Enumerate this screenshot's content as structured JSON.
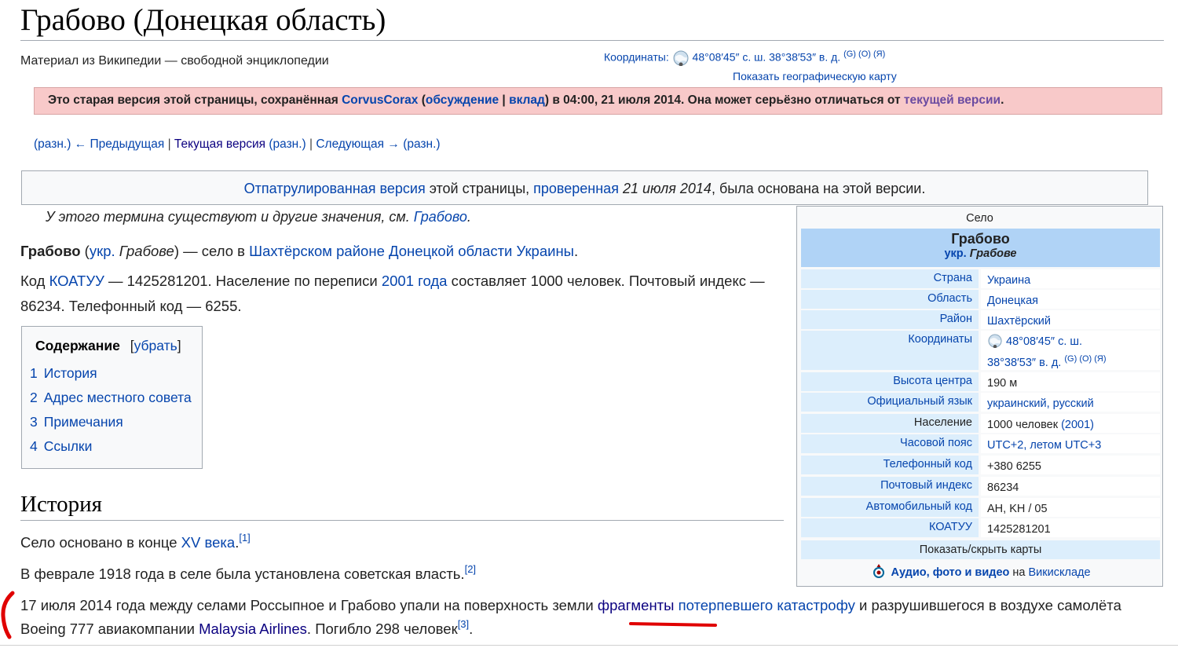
{
  "page": {
    "title": "Грабово (Донецкая область)",
    "tagline": "Материал из Википедии — свободной энциклопедии"
  },
  "coordinates": {
    "label": "Координаты:",
    "value": "48°08′45″ с. ш. 38°38′53″ в. д.",
    "g": "(G)",
    "o": "(O)",
    "ya": "(Я)",
    "map_link": "Показать географическую карту"
  },
  "old_version": {
    "prefix": "Это старая версия этой страницы, сохранённая ",
    "user": "CorvusCorax",
    "open": " (",
    "talk": "обсуждение",
    "sep": " | ",
    "contrib": "вклад",
    "close": ")",
    "middle": " в 04:00, 21 июля 2014. Она может серьёзно отличаться от ",
    "current": "текущей версии",
    "end": "."
  },
  "revision_nav": {
    "diff1": "(разн.)",
    "prev": "← Предыдущая",
    "sep1": " | ",
    "current": "Текущая версия",
    "diff2": "(разн.)",
    "sep2": " | ",
    "next": "Следующая →",
    "diff3": "(разн.)"
  },
  "patrol": {
    "link1": "Отпатрулированная версия",
    "text1": " этой страницы, ",
    "link2": "проверенная",
    "date": " 21 июля 2014",
    "text2": ", была основана на этой версии."
  },
  "hatnote": {
    "text": "У этого термина существуют и другие значения, см. ",
    "link": "Грабово",
    "end": "."
  },
  "lead": {
    "name": "Грабово",
    "ukr_open": " (",
    "ukr_link": "укр.",
    "ukr_name": " Грабове",
    "ukr_close": ")",
    "dash": " — село в ",
    "district": "Шахтёрском районе",
    "space1": " ",
    "oblast": "Донецкой области",
    "space2": " ",
    "country": "Украины",
    "end": "."
  },
  "lead2": {
    "code_label": "Код ",
    "koatuu": "КОАТУУ",
    "text1": " — 1425281201. Население по переписи ",
    "census": "2001 года",
    "text2": " составляет 1000 человек. Почтовый индекс — 86234. Телефонный код — 6255."
  },
  "toc": {
    "title": "Содержание",
    "toggle_open": "[",
    "toggle": "убрать",
    "toggle_close": "]",
    "items": [
      {
        "num": "1",
        "label": "История"
      },
      {
        "num": "2",
        "label": "Адрес местного совета"
      },
      {
        "num": "3",
        "label": "Примечания"
      },
      {
        "num": "4",
        "label": "Ссылки"
      }
    ]
  },
  "history": {
    "heading": "История",
    "p1_text": "Село основано в конце ",
    "p1_link": "XV века",
    "p1_end": ".",
    "p1_ref": "[1]",
    "p2_text": "В феврале 1918 года в селе была установлена советская власть.",
    "p2_ref": "[2]",
    "p3_text1": "17 июля 2014 года между селами Россыпное и Грабово упали на поверхность земли ",
    "p3_link1": "фрагменты",
    "p3_space": " ",
    "p3_link2": "потерпевшего катастрофу",
    "p3_text2": " и разрушившегося в воздухе самолёта Boeing 777 авиакомпании ",
    "p3_link3": "Malaysia Airlines",
    "p3_text3": ". Погибло 298 человек",
    "p3_ref": "[3]",
    "p3_end": "."
  },
  "infobox": {
    "caption": "Село",
    "name": "Грабово",
    "ukr_label": "укр.",
    "ukr_name": " Грабове",
    "rows": [
      {
        "label": "Страна",
        "value": "Украина"
      },
      {
        "label": "Область",
        "value": "Донецкая"
      },
      {
        "label": "Район",
        "value": "Шахтёрский"
      },
      {
        "label": "Координаты",
        "value": "48°08′45″ с. ш. 38°38′53″ в. д."
      },
      {
        "label": "Высота центра",
        "value": "190 м"
      },
      {
        "label": "Официальный язык",
        "value": "украинский, русский"
      },
      {
        "label": "Население",
        "value": "1000 человек",
        "extra": "(2001)"
      },
      {
        "label": "Часовой пояс",
        "value": "UTC+2, летом UTC+3"
      },
      {
        "label": "Телефонный код",
        "value": "+380 6255"
      },
      {
        "label": "Почтовый индекс",
        "value": "86234"
      },
      {
        "label": "Автомобильный код",
        "value": "AH, KH / 05"
      },
      {
        "label": "КОАТУУ",
        "value": "1425281201"
      }
    ],
    "coords_line1": "48°08′45″ с. ш.",
    "coords_line2": "38°38′53″ в. д.",
    "g": "(G)",
    "o": "(O)",
    "ya": "(Я)",
    "toggle_maps": "Показать/скрыть карты",
    "commons_link": "Аудио, фото и видео",
    "commons_on": " на ",
    "commons_site": "Викискладе"
  },
  "colors": {
    "link": "#0645ad",
    "banner_bg": "#f8c9c9",
    "infobox_header": "#b0d3f6",
    "infobox_label": "#dceefc",
    "annotation": "#e00000"
  }
}
